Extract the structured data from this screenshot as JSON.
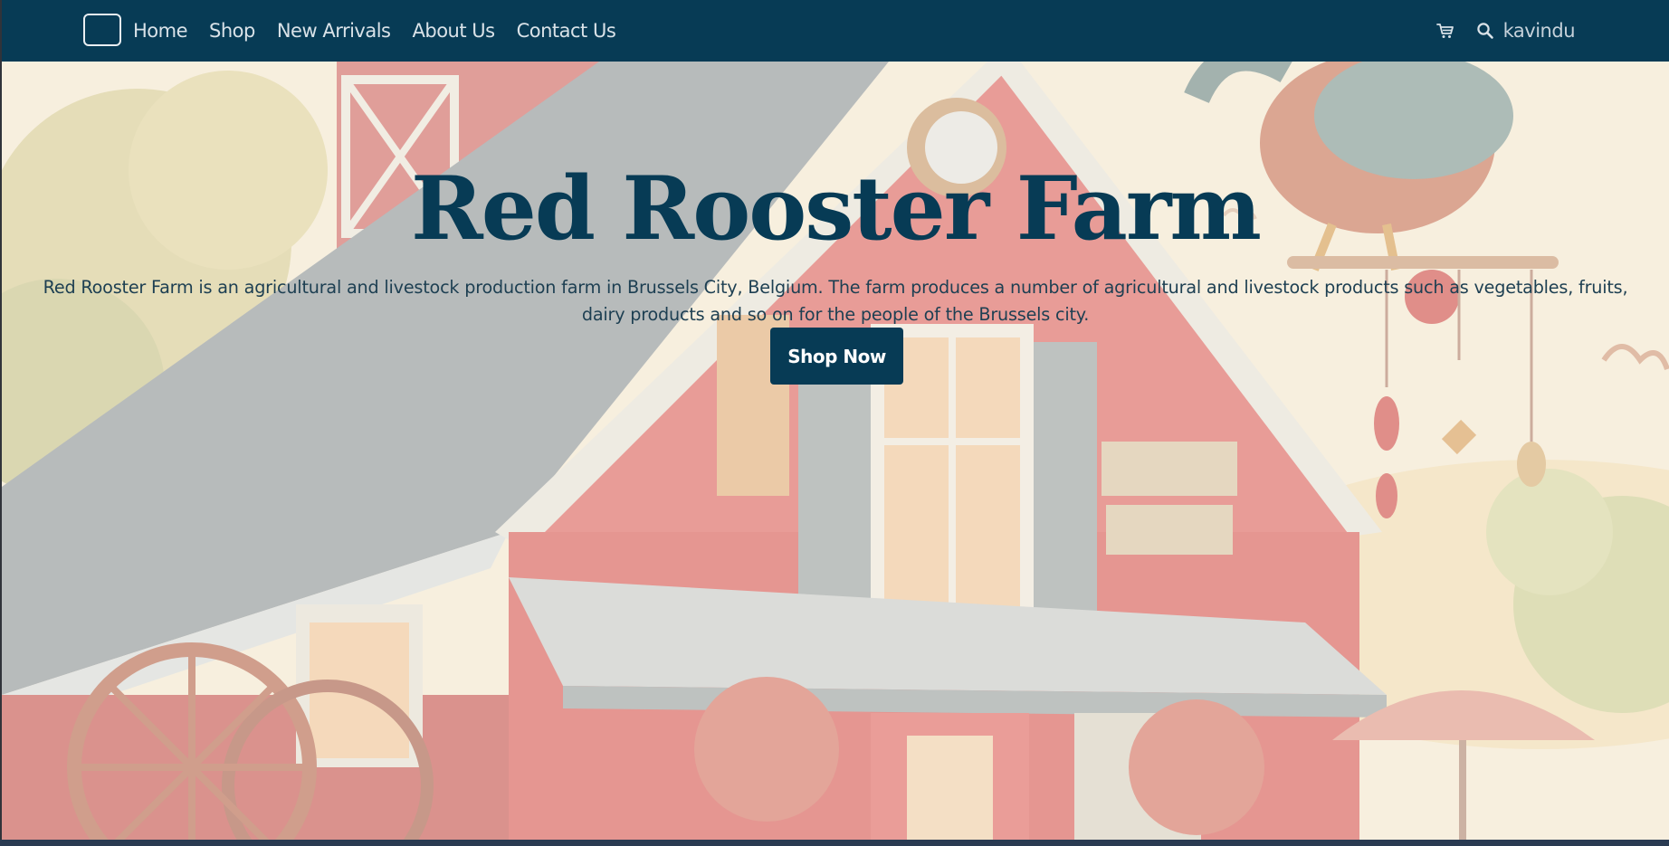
{
  "nav": {
    "links": [
      "Home",
      "Shop",
      "New Arrivals",
      "About Us",
      "Contact Us"
    ],
    "cart_icon": "cart-icon",
    "search_icon": "search-icon",
    "username": "kavindu"
  },
  "hero": {
    "title": "Red Rooster Farm",
    "description_line1": "Red Rooster Farm is an agricultural and livestock production farm in Brussels City, Belgium. The farm produces a number of agricultural and livestock products such as vegetables, fruits,",
    "description_line2": "dairy products and so on for the people of the Brussels city.",
    "button_label": "Shop Now"
  },
  "colors": {
    "navbar": "#073b55",
    "accent": "#073b55",
    "barn_red": "#d9555a"
  }
}
